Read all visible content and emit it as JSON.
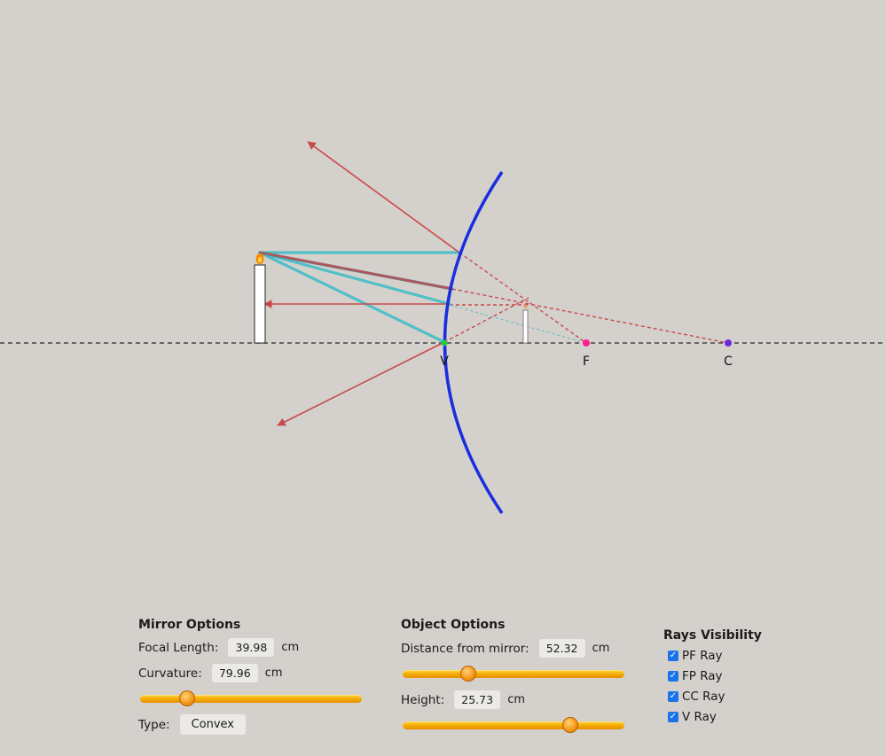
{
  "diagram": {
    "mirror_type": "Convex",
    "points": {
      "vertex": "V",
      "focus": "F",
      "center": "C"
    },
    "colors": {
      "mirror": "#1a2ee0",
      "incident_ray": "#4fbfc8",
      "reflected_ray": "#c74b4b",
      "principal_axis": "#444444",
      "focus_point": "#ff1f8f",
      "center_point": "#6a2bd9",
      "vertex_point": "#22cc44",
      "object_flame": "#ff8800"
    }
  },
  "mirror_options": {
    "title": "Mirror Options",
    "focal_label": "Focal Length:",
    "focal_value": "39.98",
    "focal_unit": "cm",
    "curvature_label": "Curvature:",
    "curvature_value": "79.96",
    "curvature_unit": "cm",
    "curvature_slider_level": 0.21,
    "type_label": "Type:",
    "type_value": "Convex"
  },
  "object_options": {
    "title": "Object Options",
    "distance_label": "Distance from mirror:",
    "distance_value": "52.32",
    "distance_unit": "cm",
    "distance_slider_level": 0.295,
    "height_label": "Height:",
    "height_value": "25.73",
    "height_unit": "cm",
    "height_slider_level": 0.755
  },
  "rays_visibility": {
    "title": "Rays Visibility",
    "items": [
      {
        "label": "PF Ray",
        "checked": true
      },
      {
        "label": "FP Ray",
        "checked": true
      },
      {
        "label": "CC Ray",
        "checked": true
      },
      {
        "label": "V Ray",
        "checked": true
      }
    ]
  }
}
